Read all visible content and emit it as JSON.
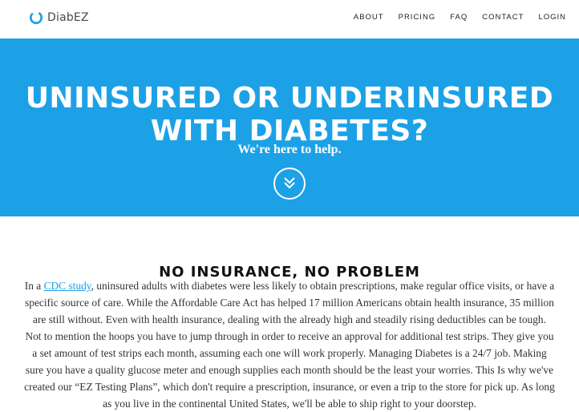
{
  "brand": {
    "name": "DiabEZ",
    "logo_icon": "ring-logo-icon",
    "accent": "#1da1e6"
  },
  "nav": {
    "items": [
      {
        "label": "ABOUT"
      },
      {
        "label": "PRICING"
      },
      {
        "label": "FAQ"
      },
      {
        "label": "CONTACT"
      },
      {
        "label": "LOGIN"
      }
    ]
  },
  "hero": {
    "title_line1": "UNINSURED OR UNDERINSURED",
    "title_line2": "WITH DIABETES?",
    "subtitle": "We're here to help.",
    "scroll_icon": "double-chevron-down-icon",
    "background": "#1da1e6"
  },
  "section": {
    "title": "NO INSURANCE, NO PROBLEM",
    "intro_before_link": "In a ",
    "link_text": "CDC study",
    "intro_after_link": ", uninsured adults with diabetes were less likely to obtain prescriptions, make regular office visits, or have a specific source of care. While the Affordable Care Act has helped 17 million Americans obtain health insurance, 35 million are still without. Even with health insurance, dealing with the already high and steadily rising deductibles can be tough. Not to mention the hoops you have to jump through in order to receive an approval for additional test strips. They give you a set amount of test strips each month, assuming each one will work properly. Managing Diabetes is a 24/7 job. Making sure you have a quality glucose meter and enough supplies each month should be the least your worries. This Is why we've created our “EZ Testing Plans”, which don't require a prescription, insurance, or even a trip to the store for pick up. As long as you live in the continental United States, we'll be able to ship right to your doorstep."
  }
}
